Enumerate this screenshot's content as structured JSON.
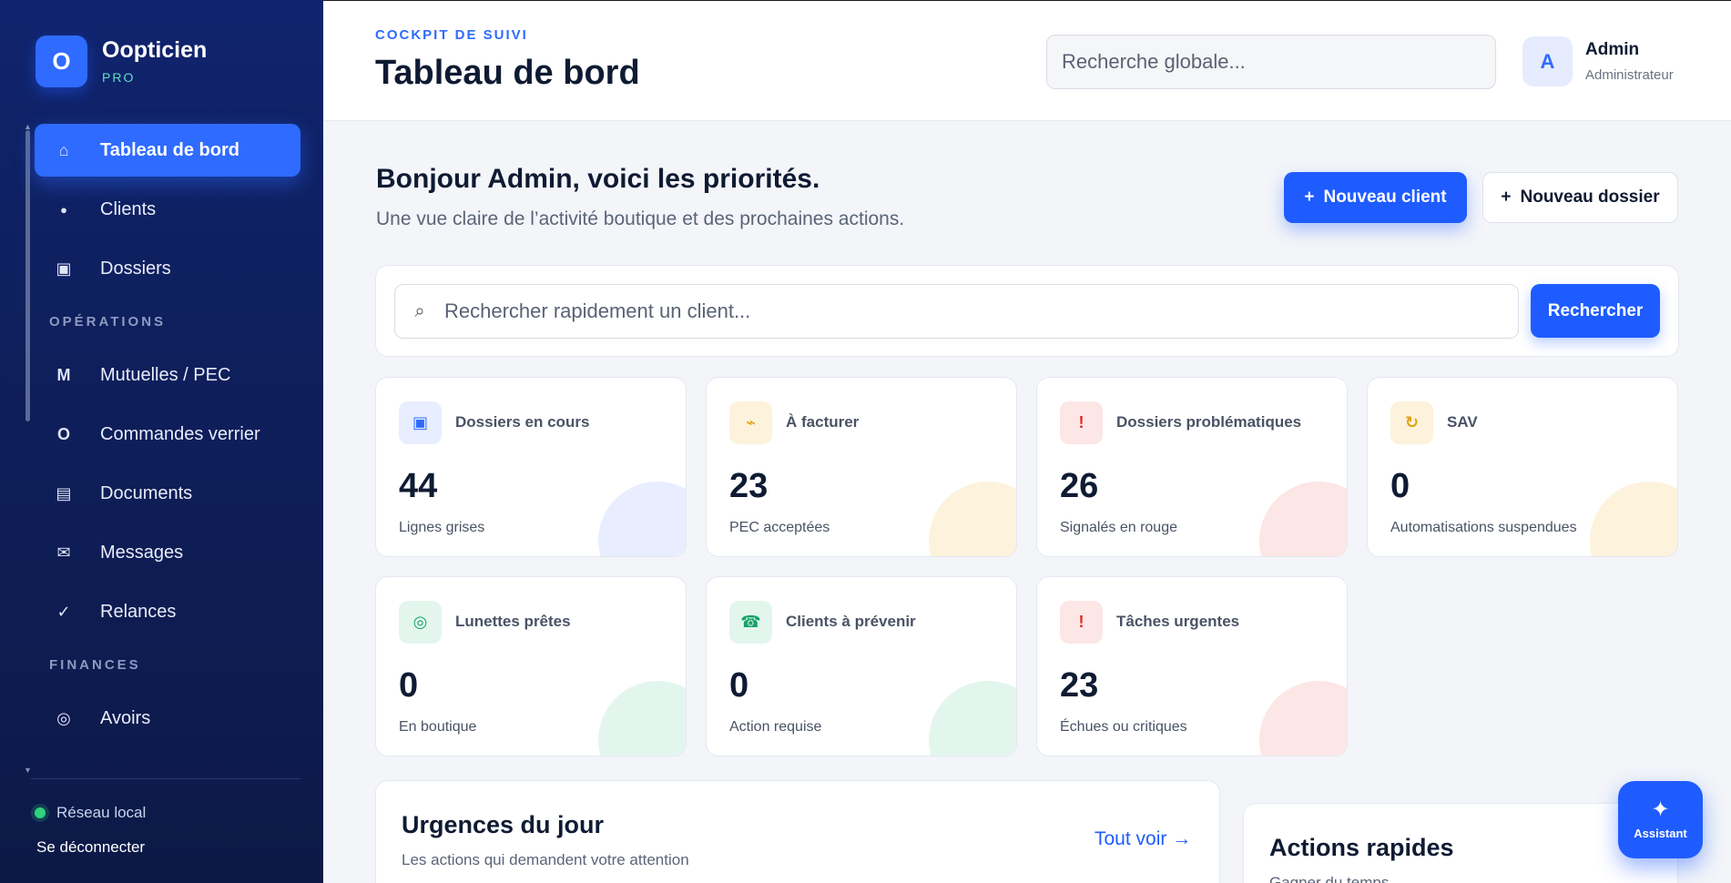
{
  "brand": {
    "logo_letter": "O",
    "name": "Oopticien",
    "tier": "PRO"
  },
  "nav": {
    "items": [
      {
        "label": "Tableau de bord",
        "icon": "⌂",
        "icon_name": "home-icon",
        "active": true
      },
      {
        "label": "Clients",
        "icon": "●",
        "icon_name": "dot-icon"
      },
      {
        "label": "Dossiers",
        "icon": "▣",
        "icon_name": "folder-icon"
      }
    ],
    "section_operations": "OPÉRATIONS",
    "operations": [
      {
        "label": "Mutuelles / PEC",
        "icon": "M",
        "icon_name": "mutuelle-icon"
      },
      {
        "label": "Commandes verrier",
        "icon": "O",
        "icon_name": "order-icon"
      },
      {
        "label": "Documents",
        "icon": "▤",
        "icon_name": "document-icon"
      },
      {
        "label": "Messages",
        "icon": "✉",
        "icon_name": "mail-icon"
      },
      {
        "label": "Relances",
        "icon": "✓",
        "icon_name": "check-icon"
      }
    ],
    "section_finances": "FINANCES",
    "finances": [
      {
        "label": "Avoirs",
        "icon": "◎",
        "icon_name": "credit-icon"
      }
    ]
  },
  "footer": {
    "network": "Réseau local",
    "logout": "Se déconnecter"
  },
  "header": {
    "kicker": "COCKPIT DE SUIVI",
    "title": "Tableau de bord",
    "search_placeholder": "Recherche globale...",
    "user": {
      "initial": "A",
      "name": "Admin",
      "role": "Administrateur"
    }
  },
  "main": {
    "greeting": "Bonjour Admin, voici les priorités.",
    "greeting_sub": "Une vue claire de l’activité boutique et des prochaines actions.",
    "new_client": "Nouveau client",
    "new_dossier": "Nouveau dossier",
    "plus": "+",
    "quick_search_placeholder": "Rechercher rapidement un client...",
    "search_icon": "⌕",
    "search_button": "Rechercher"
  },
  "stats": [
    {
      "label": "Dossiers en cours",
      "value": "44",
      "sub": "Lignes grises",
      "icon": "▣",
      "icon_name": "folder-icon",
      "icon_color": "#2f6bff",
      "icon_bg": "#e8eeff",
      "blob": "#e8eeff"
    },
    {
      "label": "À facturer",
      "value": "23",
      "sub": "PEC acceptées",
      "icon": "⌁",
      "icon_name": "invoice-icon",
      "icon_color": "#e0a114",
      "icon_bg": "#fdf2dc",
      "blob": "#fdf2dc"
    },
    {
      "label": "Dossiers problématiques",
      "value": "26",
      "sub": "Signalés en rouge",
      "icon": "!",
      "icon_name": "alert-icon",
      "icon_color": "#d92d20",
      "icon_bg": "#fde6e6",
      "blob": "#fde6e6"
    },
    {
      "label": "SAV",
      "value": "0",
      "sub": "Automatisations suspendues",
      "icon": "↻",
      "icon_name": "refresh-icon",
      "icon_color": "#e0a114",
      "icon_bg": "#fdf2dc",
      "blob": "#fdf2dc"
    },
    {
      "label": "Lunettes prêtes",
      "value": "0",
      "sub": "En boutique",
      "icon": "◎",
      "icon_name": "glasses-icon",
      "icon_color": "#16a36a",
      "icon_bg": "#e3f6ee",
      "blob": "#e3f6ee"
    },
    {
      "label": "Clients à prévenir",
      "value": "0",
      "sub": "Action requise",
      "icon": "☎",
      "icon_name": "phone-icon",
      "icon_color": "#16a36a",
      "icon_bg": "#e3f6ee",
      "blob": "#e3f6ee"
    },
    {
      "label": "Tâches urgentes",
      "value": "23",
      "sub": "Échues ou critiques",
      "icon": "!",
      "icon_name": "alert-icon",
      "icon_color": "#d92d20",
      "icon_bg": "#fde6e6",
      "blob": "#fde6e6"
    }
  ],
  "urgences": {
    "title": "Urgences du jour",
    "sub": "Les actions qui demandent votre attention",
    "see_all": "Tout voir →"
  },
  "actions": {
    "title": "Actions rapides",
    "sub": "Gagner du temps"
  },
  "assistant": {
    "icon": "✦",
    "label": "Assistant"
  },
  "colors": {
    "accent": "#1f5cff",
    "sidebar": "#0f2060",
    "teal": "#5ee0c6"
  }
}
